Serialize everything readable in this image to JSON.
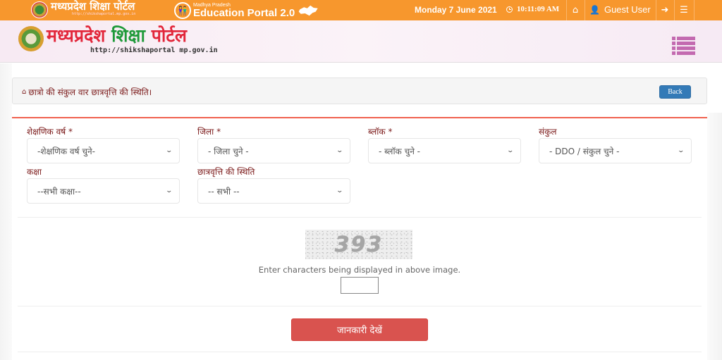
{
  "topbar": {
    "portal_logo_title": "मध्यप्रदेश शिक्षा पोर्टल",
    "portal_logo_url": "http://shikshaportal.mp.gov.in",
    "edu_portal_subtitle": "Madhya Pradesh",
    "edu_portal_title": "Education Portal 2.0",
    "date": "Monday 7 June 2021",
    "time": "10:11:09 AM",
    "home_icon": "home-icon",
    "user_label": "Guest User",
    "login_icon": "sign-in-icon",
    "menu_icon": "list-icon"
  },
  "header": {
    "title_part1": "मध्यप्रदेश",
    "title_part2": "शिक्षा",
    "title_part3": "पोर्टल",
    "url": "http://shikshaportal mp.gov.in",
    "menu_icon": "list-icon"
  },
  "breadcrumb": {
    "icon": "home-icon",
    "title": "छात्रो की संकुल वार छात्रवृत्ति की स्थिति।",
    "back_label": "Back"
  },
  "form": {
    "fields": [
      {
        "label": "शेक्षणिक वर्ष *",
        "selected": "-शेक्षणिक वर्ष चुने-"
      },
      {
        "label": "जिला *",
        "selected": "- जिला चुने -"
      },
      {
        "label": "ब्लॉक *",
        "selected": "- ब्लॉक चुने -"
      },
      {
        "label": "संकुल",
        "selected": "- DDO / संकुल चुने -"
      },
      {
        "label": "कक्षा",
        "selected": "--सभी कक्षा--"
      },
      {
        "label": "छात्रवृत्ति की स्थिति",
        "selected": "-- सभी --"
      }
    ],
    "captcha_text": "393",
    "captcha_hint": "Enter characters being displayed in above image.",
    "captcha_input_value": "",
    "submit_label": "जानकारी देखें"
  },
  "colors": {
    "topbar_bg": "#f7972d",
    "label_color": "#7b1a1a",
    "back_button": "#337ab7",
    "submit_button": "#d9534f",
    "accent_line": "#f0614f",
    "menu_icon": "#c36ab0"
  }
}
